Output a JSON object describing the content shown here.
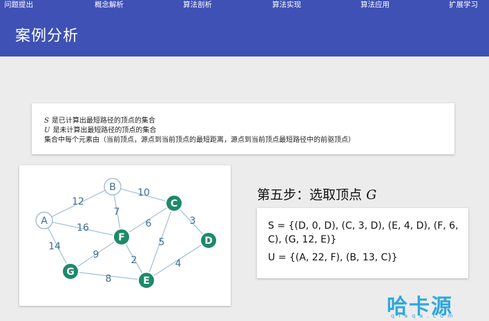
{
  "nav": {
    "items": [
      "问题提出",
      "概念解析",
      "算法剖析",
      "算法实现",
      "算法应用",
      "扩展学习"
    ]
  },
  "header": {
    "title": "案例分析"
  },
  "definitions": {
    "s_var": "S",
    "s_text": "是已计算出最短路径的顶点的集合",
    "u_var": "U",
    "u_text": "是未计算出最短路径的顶点的集合",
    "element_text": "集合中每个元素由（当前顶点，源点到当前顶点的最短距离，源点到当前顶点最短路径中的前驱顶点）"
  },
  "graph": {
    "nodes": [
      {
        "id": "A",
        "label": "A",
        "state": "unvisited"
      },
      {
        "id": "B",
        "label": "B",
        "state": "unvisited"
      },
      {
        "id": "C",
        "label": "C",
        "state": "visited"
      },
      {
        "id": "D",
        "label": "D",
        "state": "visited"
      },
      {
        "id": "E",
        "label": "E",
        "state": "visited"
      },
      {
        "id": "F",
        "label": "F",
        "state": "visited"
      },
      {
        "id": "G",
        "label": "G",
        "state": "visited"
      }
    ],
    "edges": [
      {
        "from": "A",
        "to": "B",
        "weight": "12"
      },
      {
        "from": "A",
        "to": "F",
        "weight": "16"
      },
      {
        "from": "A",
        "to": "G",
        "weight": "14"
      },
      {
        "from": "B",
        "to": "C",
        "weight": "10"
      },
      {
        "from": "B",
        "to": "F",
        "weight": "7"
      },
      {
        "from": "C",
        "to": "F",
        "weight": "6"
      },
      {
        "from": "C",
        "to": "D",
        "weight": "3"
      },
      {
        "from": "C",
        "to": "E",
        "weight": "5"
      },
      {
        "from": "F",
        "to": "G",
        "weight": "9"
      },
      {
        "from": "F",
        "to": "E",
        "weight": "2"
      },
      {
        "from": "D",
        "to": "E",
        "weight": "4"
      },
      {
        "from": "G",
        "to": "E",
        "weight": "8"
      }
    ],
    "colors": {
      "visited_fill": "#1e8a6a",
      "unvisited_stroke": "#9bb7cf",
      "edge": "#a6c2d8",
      "weight_text": "#3c6f93"
    }
  },
  "step": {
    "text": "第五步：选取顶点",
    "var": "G"
  },
  "sets": {
    "s": "S = {(D, 0, D), (C, 3, D), (E, 4, D), (F, 6, C), (G, 12, E)}",
    "u": "U = {(A, 22, F), (B, 13, C)}"
  },
  "watermark": {
    "text": "哈卡源",
    "url": "qiaqa.com"
  }
}
